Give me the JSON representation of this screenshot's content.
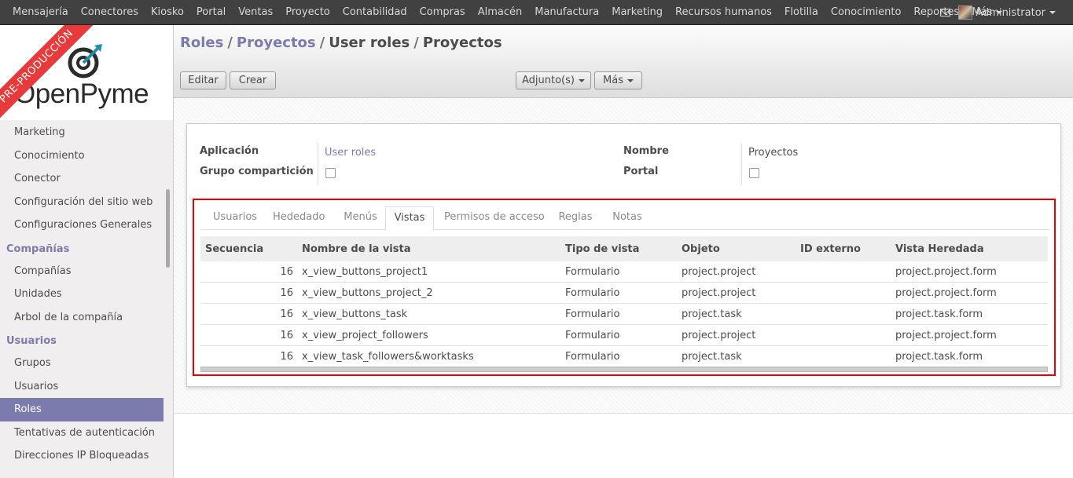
{
  "topbar": {
    "menu": [
      "Mensajería",
      "Conectores",
      "Kiosko",
      "Portal",
      "Ventas",
      "Proyecto",
      "Contabilidad",
      "Compras",
      "Almacén",
      "Manufactura",
      "Marketing",
      "Recursos humanos",
      "Flotilla",
      "Conocimiento",
      "Reportes",
      "Más"
    ],
    "user": "Administrator"
  },
  "sidebar": {
    "logo": "OpenPyme",
    "ribbon": "PRE-PRODUCCIÓN",
    "items": [
      {
        "type": "item",
        "label": "Marketing"
      },
      {
        "type": "item",
        "label": "Conocimiento"
      },
      {
        "type": "item",
        "label": "Conector"
      },
      {
        "type": "item",
        "label": "Configuración del sitio web"
      },
      {
        "type": "item",
        "label": "Configuraciones Generales"
      },
      {
        "type": "header",
        "label": "Compañías"
      },
      {
        "type": "item",
        "label": "Compañías"
      },
      {
        "type": "item",
        "label": "Unidades"
      },
      {
        "type": "item",
        "label": "Arbol de la compañía"
      },
      {
        "type": "header",
        "label": "Usuarios"
      },
      {
        "type": "item",
        "label": "Grupos"
      },
      {
        "type": "item",
        "label": "Usuarios"
      },
      {
        "type": "item",
        "label": "Roles",
        "active": true
      },
      {
        "type": "item",
        "label": "Tentativas de autenticación"
      },
      {
        "type": "item",
        "label": "Direcciones IP Bloqueadas"
      }
    ]
  },
  "breadcrumb": {
    "b1": "Roles",
    "b2": "Proyectos",
    "b3": "User roles",
    "b4": "Proyectos"
  },
  "buttons": {
    "edit": "Editar",
    "create": "Crear",
    "attach": "Adjunto(s)",
    "more": "Más"
  },
  "form": {
    "app_label": "Aplicación",
    "app_value": "User roles",
    "share_label": "Grupo compartición",
    "name_label": "Nombre",
    "name_value": "Proyectos",
    "portal_label": "Portal"
  },
  "tabs": [
    "Usuarios",
    "Hededado",
    "Menús",
    "Vistas",
    "Permisos de acceso",
    "Reglas",
    "Notas"
  ],
  "active_tab": "Vistas",
  "table": {
    "columns": [
      "Secuencia",
      "Nombre de la vista",
      "Tipo de vista",
      "Objeto",
      "ID externo",
      "Vista Heredada"
    ],
    "rows": [
      [
        "16",
        "x_view_buttons_project1",
        "Formulario",
        "project.project",
        "",
        "project.project.form"
      ],
      [
        "16",
        "x_view_buttons_project_2",
        "Formulario",
        "project.project",
        "",
        "project.project.form"
      ],
      [
        "16",
        "x_view_buttons_task",
        "Formulario",
        "project.task",
        "",
        "project.task.form"
      ],
      [
        "16",
        "x_view_project_followers",
        "Formulario",
        "project.project",
        "",
        "project.project.form"
      ],
      [
        "16",
        "x_view_task_followers&worktasks",
        "Formulario",
        "project.task",
        "",
        "project.task.form"
      ]
    ]
  },
  "colors": {
    "accent": "#7c7bad",
    "highlight_border": "#e00000"
  }
}
